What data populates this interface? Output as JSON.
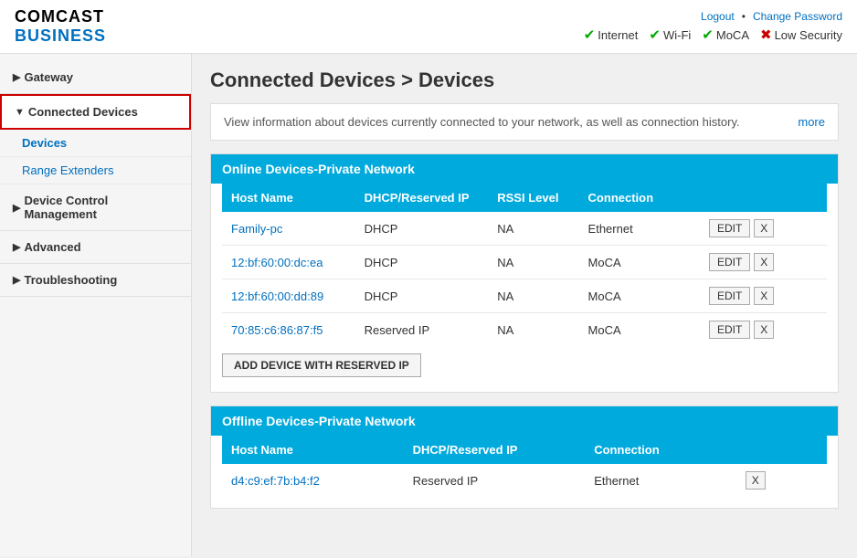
{
  "header": {
    "logo_comcast": "COMCAST",
    "logo_business": "BUSINESS",
    "links": {
      "logout": "Logout",
      "separator": "•",
      "change_password": "Change Password"
    },
    "status": [
      {
        "label": "Internet",
        "state": "ok"
      },
      {
        "label": "Wi-Fi",
        "state": "ok"
      },
      {
        "label": "MoCA",
        "state": "ok"
      },
      {
        "label": "Low Security",
        "state": "bad"
      }
    ]
  },
  "sidebar": {
    "items": [
      {
        "id": "gateway",
        "label": "Gateway",
        "arrow": "▶",
        "active": false
      },
      {
        "id": "connected-devices",
        "label": "Connected Devices",
        "arrow": "▼",
        "active": true,
        "children": [
          {
            "id": "devices",
            "label": "Devices",
            "active": true
          },
          {
            "id": "range-extenders",
            "label": "Range Extenders",
            "active": false
          }
        ]
      },
      {
        "id": "device-control",
        "label": "Device Control Management",
        "arrow": "▶",
        "active": false
      },
      {
        "id": "advanced",
        "label": "Advanced",
        "arrow": "▶",
        "active": false
      },
      {
        "id": "troubleshooting",
        "label": "Troubleshooting",
        "arrow": "▶",
        "active": false
      }
    ]
  },
  "page": {
    "title": "Connected Devices > Devices",
    "info_text": "View information about devices currently connected to your network, as well as connection history.",
    "more_link": "more"
  },
  "online_section": {
    "header": "Online Devices-Private Network",
    "columns": [
      "Host Name",
      "DHCP/Reserved IP",
      "RSSI Level",
      "Connection"
    ],
    "rows": [
      {
        "hostname": "Family-pc",
        "dhcp": "DHCP",
        "rssi": "NA",
        "connection": "Ethernet"
      },
      {
        "hostname": "12:bf:60:00:dc:ea",
        "dhcp": "DHCP",
        "rssi": "NA",
        "connection": "MoCA"
      },
      {
        "hostname": "12:bf:60:00:dd:89",
        "dhcp": "DHCP",
        "rssi": "NA",
        "connection": "MoCA"
      },
      {
        "hostname": "70:85:c6:86:87:f5",
        "dhcp": "Reserved IP",
        "rssi": "NA",
        "connection": "MoCA"
      }
    ],
    "add_btn": "ADD DEVICE WITH RESERVED IP",
    "edit_label": "EDIT",
    "x_label": "X"
  },
  "offline_section": {
    "header": "Offline Devices-Private Network",
    "columns": [
      "Host Name",
      "DHCP/Reserved IP",
      "Connection"
    ],
    "rows": [
      {
        "hostname": "d4:c9:ef:7b:b4:f2",
        "dhcp": "Reserved IP",
        "connection": "Ethernet"
      }
    ],
    "x_label": "X"
  }
}
